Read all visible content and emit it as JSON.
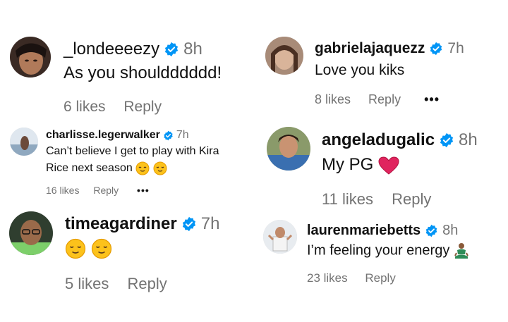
{
  "colors": {
    "verified": "#0095f6",
    "meta_text": "#737373",
    "heart": "#e0245e"
  },
  "comments": [
    {
      "username": "_londeeeezy",
      "verified": true,
      "time": "8h",
      "text": "As you shouldddddd!",
      "likes": "6 likes",
      "reply": "Reply"
    },
    {
      "username": "gabrielajaquezz",
      "verified": true,
      "time": "7h",
      "text": "Love you kiks",
      "likes": "8 likes",
      "reply": "Reply",
      "more": "•••"
    },
    {
      "username": "charlisse.legerwalker",
      "verified": true,
      "time": "7h",
      "text_line1": "Can’t believe I get to play with Kira",
      "text_line2": "Rice next season",
      "emojis": [
        "relieved-face",
        "relieved-face"
      ],
      "likes": "16 likes",
      "reply": "Reply",
      "more": "•••"
    },
    {
      "username": "angeladugalic",
      "verified": true,
      "time": "8h",
      "text": "My PG",
      "emojis": [
        "red-heart"
      ],
      "likes": "11 likes",
      "reply": "Reply"
    },
    {
      "username": "timeagardiner",
      "verified": true,
      "time": "7h",
      "emojis": [
        "relieved-face",
        "relieved-face"
      ],
      "likes": "5 likes",
      "reply": "Reply"
    },
    {
      "username": "laurenmariebetts",
      "verified": true,
      "time": "8h",
      "text": "I’m feeling your energy",
      "emojis": [
        "person-in-lotus-position"
      ],
      "likes": "23 likes",
      "reply": "Reply"
    }
  ]
}
